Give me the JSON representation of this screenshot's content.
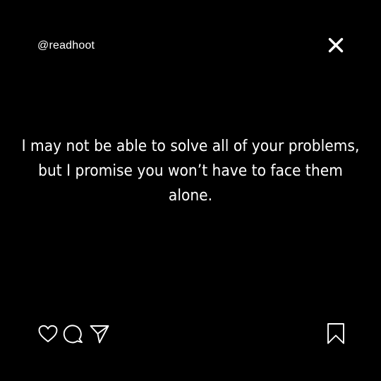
{
  "post": {
    "username": "@readhoot",
    "quote": "I may not be able to solve all of your problems, but I promise you won’t have to face them alone."
  },
  "icons": {
    "close": "close-icon",
    "like": "heart-icon",
    "comment": "comment-bubble-icon",
    "share": "send-icon",
    "save": "bookmark-icon"
  },
  "colors": {
    "background": "#000000",
    "foreground": "#ffffff"
  }
}
